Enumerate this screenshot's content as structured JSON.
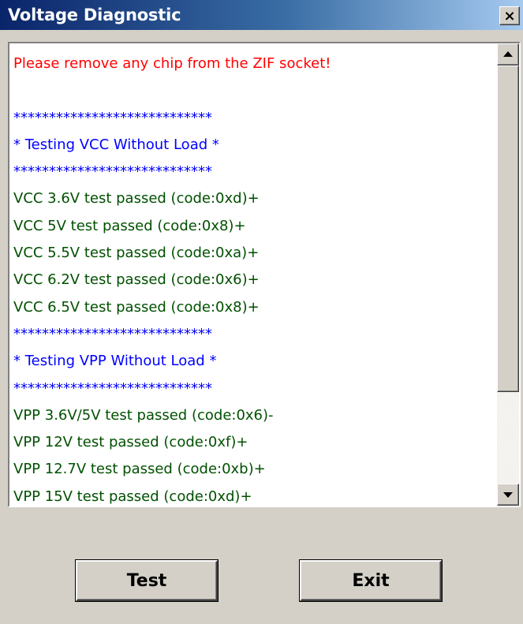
{
  "window": {
    "title": "Voltage Diagnostic",
    "close_label": "×"
  },
  "colors": {
    "red": "#ff0000",
    "blue": "#0000ff",
    "green": "#005000",
    "title_bar_start": "#0a246a",
    "title_bar_end": "#a6caf0",
    "dialog_bg": "#d4d0c8"
  },
  "log": {
    "lines": [
      {
        "text": "Please remove any chip from the ZIF socket!",
        "color": "red"
      },
      {
        "text": "",
        "color": "blue"
      },
      {
        "text": "****************************",
        "color": "blue"
      },
      {
        "text": "* Testing VCC Without Load *",
        "color": "blue"
      },
      {
        "text": "****************************",
        "color": "blue"
      },
      {
        "text": "VCC 3.6V test passed (code:0xd)+",
        "color": "green"
      },
      {
        "text": "VCC 5V test passed (code:0x8)+",
        "color": "green"
      },
      {
        "text": "VCC 5.5V test passed (code:0xa)+",
        "color": "green"
      },
      {
        "text": "VCC 6.2V test passed (code:0x6)+",
        "color": "green"
      },
      {
        "text": "VCC 6.5V test passed (code:0x8)+",
        "color": "green"
      },
      {
        "text": "****************************",
        "color": "blue"
      },
      {
        "text": "* Testing VPP  Without Load *",
        "color": "blue"
      },
      {
        "text": "****************************",
        "color": "blue"
      },
      {
        "text": "VPP 3.6V/5V test passed (code:0x6)-",
        "color": "green"
      },
      {
        "text": "VPP 12V test passed (code:0xf)+",
        "color": "green"
      },
      {
        "text": "VPP 12.7V test passed (code:0xb)+",
        "color": "green"
      },
      {
        "text": "VPP 15V test passed (code:0xd)+",
        "color": "green"
      }
    ]
  },
  "buttons": {
    "test_label": "Test",
    "exit_label": "Exit"
  },
  "icons": {
    "close": "close-icon",
    "scroll_up": "arrow-up-icon",
    "scroll_down": "arrow-down-icon"
  }
}
